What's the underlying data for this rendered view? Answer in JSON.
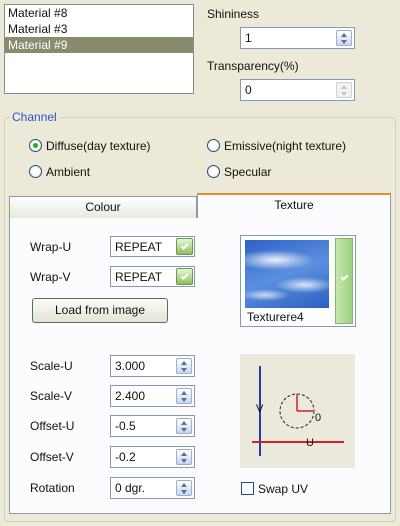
{
  "materials": {
    "items": [
      {
        "label": "Material #8",
        "selected": false
      },
      {
        "label": "Material #3",
        "selected": false
      },
      {
        "label": "Material #9",
        "selected": true
      }
    ]
  },
  "shininess": {
    "label": "Shininess",
    "value": "1"
  },
  "transparency": {
    "label": "Transparency(%)",
    "value": "0"
  },
  "channel": {
    "title": "Channel",
    "options": [
      {
        "label": "Diffuse(day texture)",
        "checked": true
      },
      {
        "label": "Emissive(night texture)",
        "checked": false
      },
      {
        "label": "Ambient",
        "checked": false
      },
      {
        "label": "Specular",
        "checked": false
      }
    ]
  },
  "tabs": [
    {
      "label": "Colour",
      "active": false
    },
    {
      "label": "Texture",
      "active": true
    }
  ],
  "texture": {
    "wrap_u": {
      "label": "Wrap-U",
      "value": "REPEAT"
    },
    "wrap_v": {
      "label": "Wrap-V",
      "value": "REPEAT"
    },
    "load_button": "Load from image",
    "preview_name": "Texturere4",
    "scale_u": {
      "label": "Scale-U",
      "value": "3.000"
    },
    "scale_v": {
      "label": "Scale-V",
      "value": "2.400"
    },
    "offset_u": {
      "label": "Offset-U",
      "value": "-0.5"
    },
    "offset_v": {
      "label": "Offset-V",
      "value": "-0.2"
    },
    "rotation": {
      "label": "Rotation",
      "value": "0 dgr."
    },
    "uv_diagram": {
      "u_label": "U",
      "v_label": "V",
      "origin_label": "0"
    },
    "swap_uv": {
      "label": "Swap UV",
      "checked": false
    }
  },
  "colors": {
    "tab_accent": "#e68b2c",
    "group_title": "#2c54c6",
    "axis_u": "#d42020",
    "axis_v": "#1c3ca8"
  }
}
